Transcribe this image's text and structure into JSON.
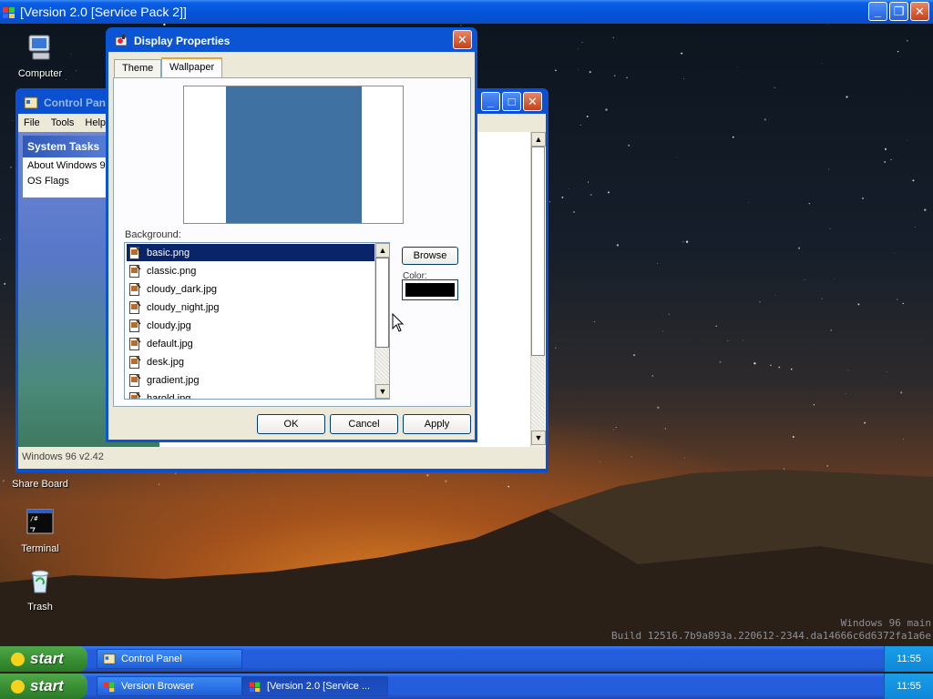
{
  "top_window": {
    "title": "[Version 2.0 [Service Pack 2]]",
    "controls": [
      "minimize",
      "restore",
      "close"
    ]
  },
  "desktop_icons": [
    {
      "label": "Computer",
      "icon": "computer-icon"
    },
    {
      "label": "Share Board",
      "icon": "share-board-icon"
    },
    {
      "label": "Terminal",
      "icon": "terminal-icon"
    },
    {
      "label": "Trash",
      "icon": "trash-icon"
    }
  ],
  "control_panel": {
    "title": "Control Panel",
    "menu": [
      "File",
      "Tools",
      "Help"
    ],
    "system_tasks": {
      "heading": "System Tasks",
      "links": [
        "About Windows 96",
        "OS Flags"
      ]
    },
    "status": "Windows 96 v2.42"
  },
  "display_properties": {
    "title": "Display Properties",
    "tabs": [
      {
        "label": "Theme",
        "active": false
      },
      {
        "label": "Wallpaper",
        "active": true
      }
    ],
    "preview_color": "#3f72a3",
    "background_label": "Background:",
    "files": [
      "basic.png",
      "classic.png",
      "cloudy_dark.jpg",
      "cloudy_night.jpg",
      "cloudy.jpg",
      "default.jpg",
      "desk.jpg",
      "gradient.jpg",
      "harold.jpg"
    ],
    "selected_file": "basic.png",
    "browse_label": "Browse",
    "color_label": "Color:",
    "color_value": "#000000",
    "buttons": {
      "ok": "OK",
      "cancel": "Cancel",
      "apply": "Apply"
    }
  },
  "build_info": {
    "line1": "Windows 96 main",
    "line2": "Build 12516.7b9a893a.220612-2344.da14666c6d6372fa1a6e"
  },
  "taskbars": [
    {
      "start_label": "start",
      "tasks": [
        {
          "label": "Control Panel",
          "active": false
        }
      ],
      "clock": "11:55"
    },
    {
      "start_label": "start",
      "tasks": [
        {
          "label": "Version Browser",
          "active": false
        },
        {
          "label": "[Version 2.0 [Service ...",
          "active": true
        }
      ],
      "clock": "11:55"
    }
  ],
  "colors": {
    "titlebar_blue": "#0453d8",
    "start_green": "#3a9134",
    "selection": "#0a246a",
    "taskbar_blue": "#245ee0"
  }
}
